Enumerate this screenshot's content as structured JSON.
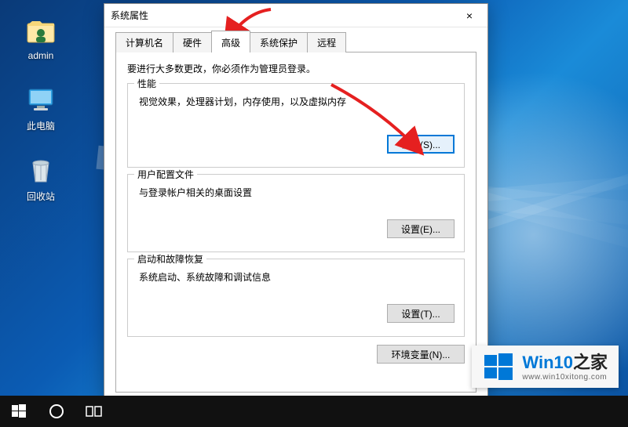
{
  "desktop": {
    "icons": [
      {
        "name": "admin",
        "label": "admin"
      },
      {
        "name": "this-pc",
        "label": "此电脑"
      },
      {
        "name": "recycle-bin",
        "label": "回收站"
      }
    ]
  },
  "dialog": {
    "title": "系统属性",
    "close": "×",
    "tabs": [
      {
        "id": "computer-name",
        "label": "计算机名"
      },
      {
        "id": "hardware",
        "label": "硬件"
      },
      {
        "id": "advanced",
        "label": "高级"
      },
      {
        "id": "system-protection",
        "label": "系统保护"
      },
      {
        "id": "remote",
        "label": "远程"
      }
    ],
    "active_tab": "advanced",
    "intro": "要进行大多数更改，你必须作为管理员登录。",
    "groups": {
      "performance": {
        "legend": "性能",
        "desc": "视觉效果，处理器计划，内存使用，以及虚拟内存",
        "button": "设置(S)..."
      },
      "user_profiles": {
        "legend": "用户配置文件",
        "desc": "与登录帐户相关的桌面设置",
        "button": "设置(E)..."
      },
      "startup_recovery": {
        "legend": "启动和故障恢复",
        "desc": "系统启动、系统故障和调试信息",
        "button": "设置(T)..."
      }
    },
    "env_button": "环境变量(N)..."
  },
  "watermark": {
    "brand_a": "Win10",
    "brand_b": "之家",
    "url": "www.win10xitong.com"
  }
}
